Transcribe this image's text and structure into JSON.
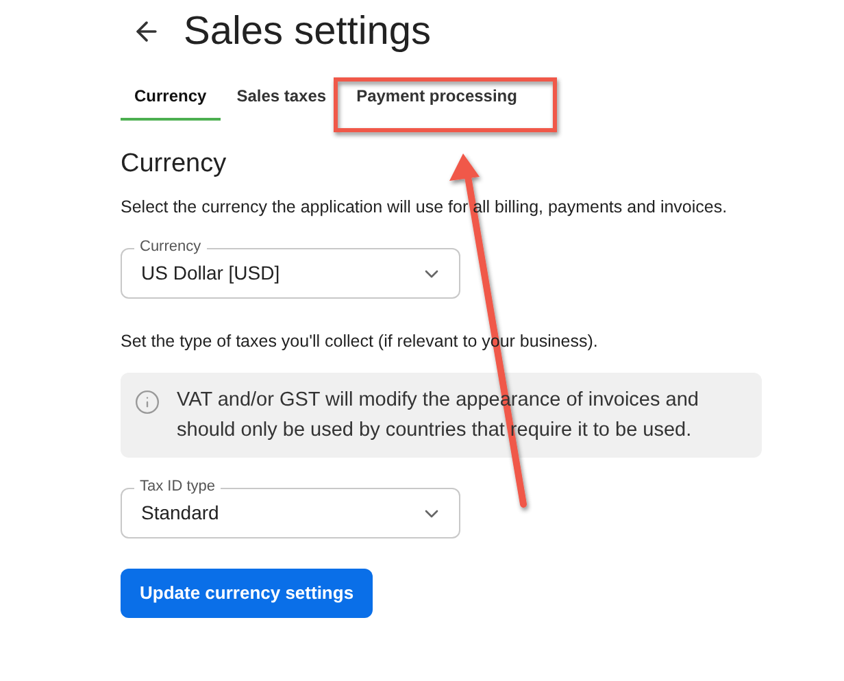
{
  "header": {
    "title": "Sales settings"
  },
  "tabs": [
    {
      "label": "Currency",
      "selected": true
    },
    {
      "label": "Sales taxes",
      "selected": false
    },
    {
      "label": "Payment processing",
      "selected": false
    }
  ],
  "currency_section": {
    "heading": "Currency",
    "description": "Select the currency the application will use for all billing, payments and invoices.",
    "select": {
      "label": "Currency",
      "value": "US Dollar [USD]"
    }
  },
  "tax_section": {
    "description": "Set the type of taxes you'll collect (if relevant to your business).",
    "notice": "VAT and/or GST will modify the appearance of invoices and should only be used by countries that require it to be used.",
    "select": {
      "label": "Tax ID type",
      "value": "Standard"
    }
  },
  "submit_button": "Update currency settings",
  "annotations": [
    {
      "kind": "box"
    },
    {
      "kind": "arrow"
    }
  ]
}
